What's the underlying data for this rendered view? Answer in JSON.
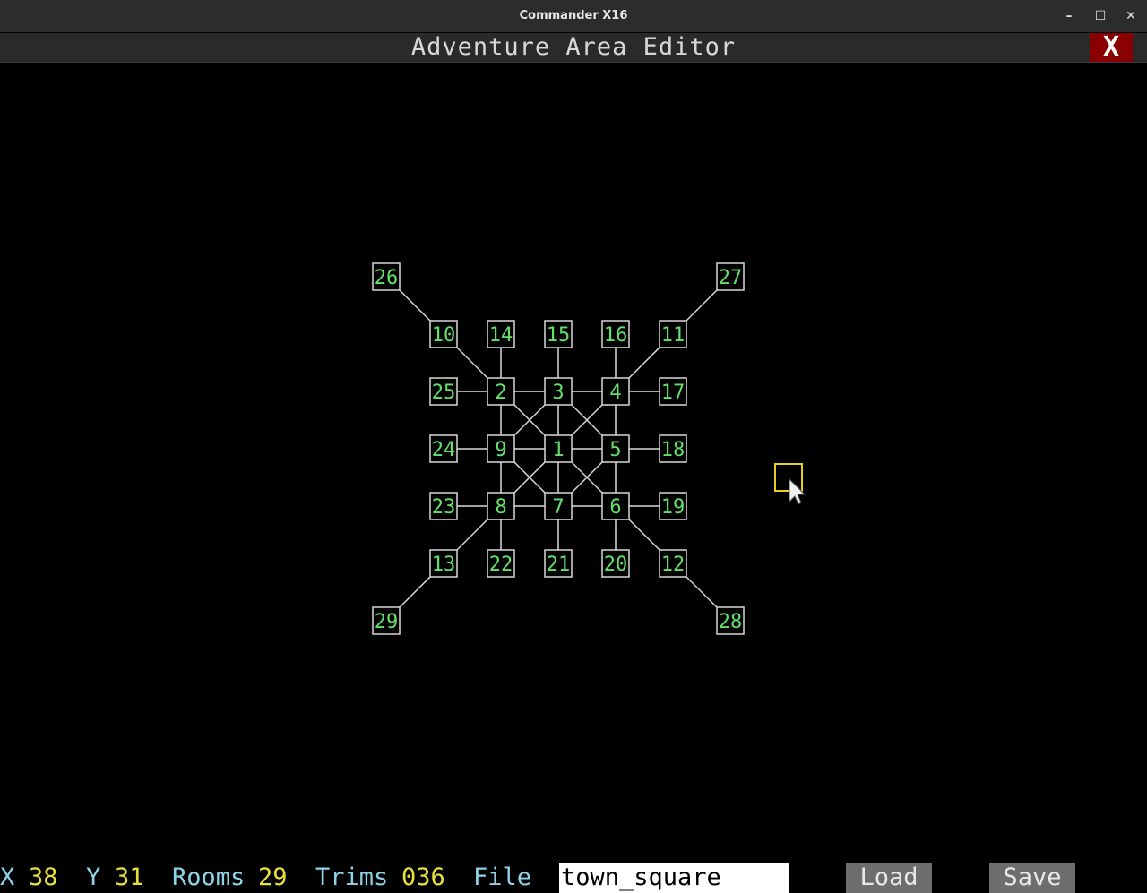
{
  "window": {
    "title": "Commander X16",
    "minimize": "–",
    "maximize": "☐",
    "close": "✕"
  },
  "app": {
    "title": "Adventure Area Editor",
    "close_label": "X"
  },
  "map": {
    "rooms": [
      {
        "id": "26",
        "col": 0,
        "row": 0
      },
      {
        "id": "27",
        "col": 6,
        "row": 0
      },
      {
        "id": "10",
        "col": 1,
        "row": 1
      },
      {
        "id": "14",
        "col": 2,
        "row": 1
      },
      {
        "id": "15",
        "col": 3,
        "row": 1
      },
      {
        "id": "16",
        "col": 4,
        "row": 1
      },
      {
        "id": "11",
        "col": 5,
        "row": 1
      },
      {
        "id": "25",
        "col": 1,
        "row": 2
      },
      {
        "id": "2",
        "col": 2,
        "row": 2
      },
      {
        "id": "3",
        "col": 3,
        "row": 2
      },
      {
        "id": "4",
        "col": 4,
        "row": 2
      },
      {
        "id": "17",
        "col": 5,
        "row": 2
      },
      {
        "id": "24",
        "col": 1,
        "row": 3
      },
      {
        "id": "9",
        "col": 2,
        "row": 3
      },
      {
        "id": "1",
        "col": 3,
        "row": 3
      },
      {
        "id": "5",
        "col": 4,
        "row": 3
      },
      {
        "id": "18",
        "col": 5,
        "row": 3
      },
      {
        "id": "23",
        "col": 1,
        "row": 4
      },
      {
        "id": "8",
        "col": 2,
        "row": 4
      },
      {
        "id": "7",
        "col": 3,
        "row": 4
      },
      {
        "id": "6",
        "col": 4,
        "row": 4
      },
      {
        "id": "19",
        "col": 5,
        "row": 4
      },
      {
        "id": "13",
        "col": 1,
        "row": 5
      },
      {
        "id": "22",
        "col": 2,
        "row": 5
      },
      {
        "id": "21",
        "col": 3,
        "row": 5
      },
      {
        "id": "20",
        "col": 4,
        "row": 5
      },
      {
        "id": "12",
        "col": 5,
        "row": 5
      },
      {
        "id": "29",
        "col": 0,
        "row": 6
      },
      {
        "id": "28",
        "col": 6,
        "row": 6
      }
    ],
    "links": [
      [
        "26",
        "10"
      ],
      [
        "10",
        "2"
      ],
      [
        "27",
        "11"
      ],
      [
        "11",
        "4"
      ],
      [
        "29",
        "13"
      ],
      [
        "13",
        "8"
      ],
      [
        "28",
        "12"
      ],
      [
        "12",
        "6"
      ],
      [
        "14",
        "2"
      ],
      [
        "15",
        "3"
      ],
      [
        "16",
        "4"
      ],
      [
        "22",
        "8"
      ],
      [
        "21",
        "7"
      ],
      [
        "20",
        "6"
      ],
      [
        "25",
        "2"
      ],
      [
        "2",
        "3"
      ],
      [
        "3",
        "4"
      ],
      [
        "4",
        "17"
      ],
      [
        "24",
        "9"
      ],
      [
        "9",
        "1"
      ],
      [
        "1",
        "5"
      ],
      [
        "5",
        "18"
      ],
      [
        "23",
        "8"
      ],
      [
        "8",
        "7"
      ],
      [
        "7",
        "6"
      ],
      [
        "6",
        "19"
      ],
      [
        "2",
        "9"
      ],
      [
        "9",
        "8"
      ],
      [
        "3",
        "1"
      ],
      [
        "1",
        "7"
      ],
      [
        "4",
        "5"
      ],
      [
        "5",
        "6"
      ],
      [
        "2",
        "1"
      ],
      [
        "1",
        "6"
      ],
      [
        "4",
        "1"
      ],
      [
        "1",
        "8"
      ],
      [
        "3",
        "9"
      ],
      [
        "9",
        "7"
      ],
      [
        "3",
        "5"
      ],
      [
        "5",
        "7"
      ]
    ],
    "room_color": "#d8d8d8",
    "label_color": "#63e06b",
    "cursor_color": "#e8d020"
  },
  "status": {
    "x_label": "X",
    "x_value": "38",
    "y_label": "Y",
    "y_value": "31",
    "rooms_label": "Rooms",
    "rooms_value": "29",
    "trims_label": "Trims",
    "trims_value": "036",
    "file_label": "File",
    "file_value": "town_square",
    "load_label": "Load",
    "save_label": "Save"
  }
}
